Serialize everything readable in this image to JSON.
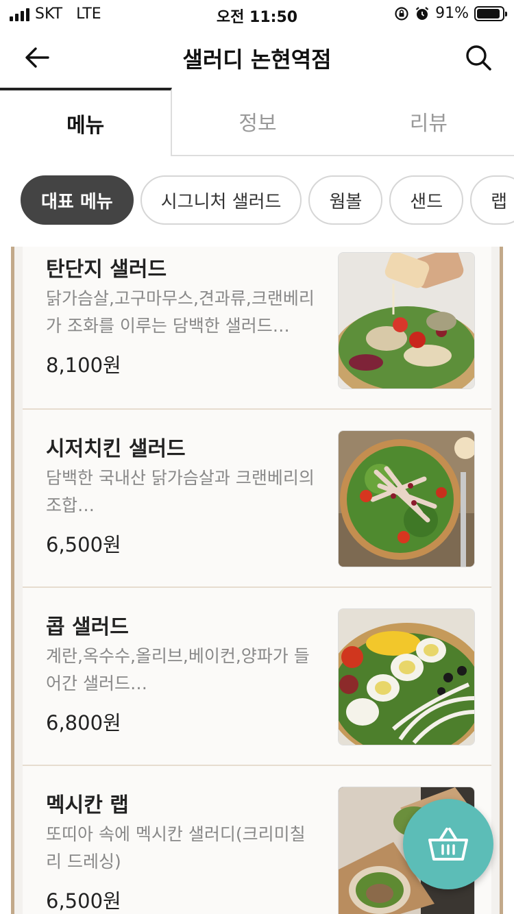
{
  "status_bar": {
    "carrier": "SKT",
    "network": "LTE",
    "time": "오전 11:50",
    "battery": "91%",
    "battery_level": 0.91
  },
  "header": {
    "title": "샐러디 논현역점"
  },
  "tabs": [
    {
      "label": "메뉴",
      "active": true
    },
    {
      "label": "정보",
      "active": false
    },
    {
      "label": "리뷰",
      "active": false
    }
  ],
  "chips": [
    {
      "label": "대표 메뉴",
      "active": true
    },
    {
      "label": "시그니처 샐러드",
      "active": false
    },
    {
      "label": "웜볼",
      "active": false
    },
    {
      "label": "샌드",
      "active": false
    },
    {
      "label": "랩",
      "active": false
    }
  ],
  "menu_items": [
    {
      "name": "탄단지 샐러드",
      "desc_line1": "닭가슴살,고구마무스,견과류,크랜베리",
      "desc_line2": "가 조화를 이루는 담백한 샐러드…",
      "price": "8,100원"
    },
    {
      "name": "시저치킨 샐러드",
      "desc_line1": "담백한 국내산 닭가슴살과 크랜베리의",
      "desc_line2": "조합…",
      "price": "6,500원"
    },
    {
      "name": "콥 샐러드",
      "desc_line1": "계란,옥수수,올리브,베이컨,양파가 들",
      "desc_line2": "어간 샐러드…",
      "price": "6,800원"
    },
    {
      "name": "멕시칸 랩",
      "desc_line1": "또띠아 속에 멕시칸 샐러디(크리미칠",
      "desc_line2": "리 드레싱)",
      "price": "6,500원"
    }
  ],
  "colors": {
    "accent_teal": "#5cbdb7",
    "chip_active": "#444444",
    "panel_border": "#c2a98a"
  },
  "icons": {
    "back": "arrow-left-icon",
    "search": "search-icon",
    "cart": "basket-icon"
  }
}
